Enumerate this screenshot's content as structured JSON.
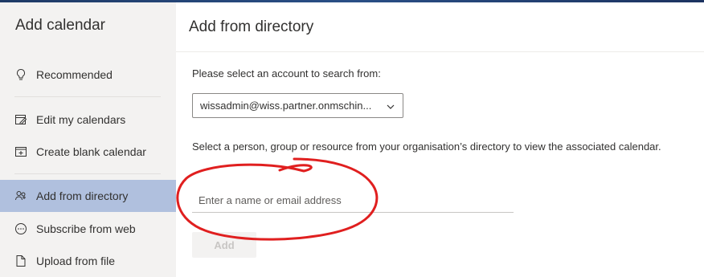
{
  "sidebar": {
    "title": "Add calendar",
    "items": [
      {
        "label": "Recommended",
        "icon": "lightbulb-icon"
      },
      {
        "label": "Edit my calendars",
        "icon": "edit-calendar-icon"
      },
      {
        "label": "Create blank calendar",
        "icon": "add-calendar-icon"
      },
      {
        "label": "Add from directory",
        "icon": "people-icon",
        "selected": true
      },
      {
        "label": "Subscribe from web",
        "icon": "globe-icon"
      },
      {
        "label": "Upload from file",
        "icon": "file-icon"
      }
    ]
  },
  "main": {
    "title": "Add from directory",
    "account_prompt": "Please select an account to search from:",
    "account_value": "wissadmin@wiss.partner.onmschin...",
    "description": "Select a person, group or resource from your organisation’s directory to view the associated calendar.",
    "search_placeholder": "Enter a name or email address",
    "add_label": "Add"
  },
  "colors": {
    "selected_nav": "#b0c0de",
    "annotation": "#e01f1f"
  }
}
